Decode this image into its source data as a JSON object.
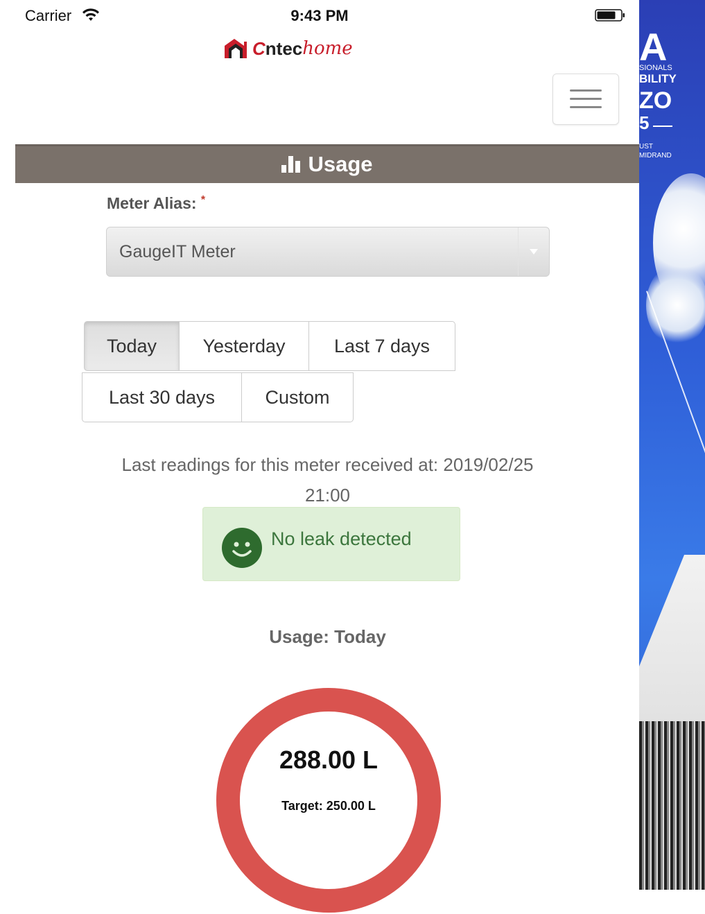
{
  "status_bar": {
    "carrier": "Carrier",
    "time": "9:43 PM"
  },
  "brand": {
    "name": "ntec",
    "script": "home",
    "accent_color": "#c81e2b"
  },
  "menu": {
    "icon": "hamburger-icon"
  },
  "section": {
    "icon": "bar-chart-icon",
    "title": "Usage",
    "bar_color": "#7a716a"
  },
  "meter_alias": {
    "label": "Meter Alias:",
    "required_mark": "*",
    "selected": "GaugeIT Meter"
  },
  "ranges": [
    {
      "label": "Today",
      "active": true
    },
    {
      "label": "Yesterday",
      "active": false
    },
    {
      "label": "Last 7 days",
      "active": false
    },
    {
      "label": "Last 30 days",
      "active": false
    },
    {
      "label": "Custom",
      "active": false
    }
  ],
  "last_reading": {
    "line1": "Last readings for this meter received at: 2019/02/25",
    "line2": "21:00"
  },
  "leak_alert": {
    "icon": "smiley-icon",
    "text": "No leak detected",
    "color": "#3c763d"
  },
  "usage": {
    "heading": "Usage: Today",
    "value": "288.00 L",
    "target": "Target: 250.00 L",
    "ring_color": "#d9534f"
  },
  "banner": {
    "letter": "A",
    "line1": "SIONALS",
    "line2": "BILITY",
    "line3": "ZO",
    "line4": "5",
    "line5": "UST",
    "line6": "MIDRAND"
  }
}
